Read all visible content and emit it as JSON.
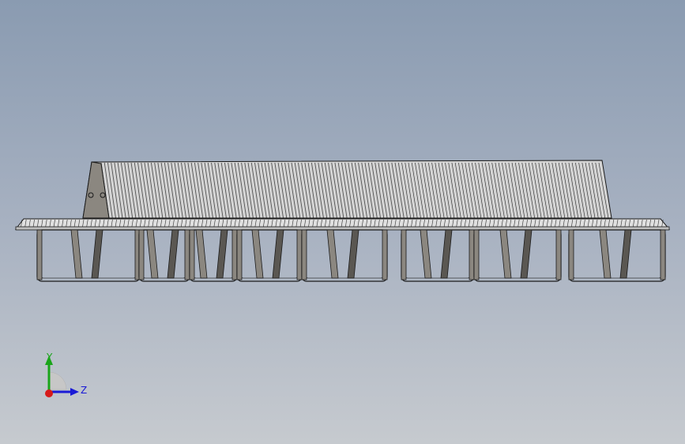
{
  "viewport": {
    "background_top": "#8a9bb1",
    "background_bottom": "#c6cacf"
  },
  "model": {
    "name": "modular-bench-assembly",
    "slat_count": 150,
    "leg_frame_count": 7,
    "colors": {
      "slat_fill": "#e6e6e6",
      "edge": "#1a1a1a",
      "leg_fill": "#8b8780",
      "leg_dark": "#5a5752"
    }
  },
  "triad": {
    "y_label": "Y",
    "z_label": "Z",
    "y_color": "#1aa51a",
    "z_color": "#1a1ad6",
    "x_color": "#d61a1a"
  }
}
